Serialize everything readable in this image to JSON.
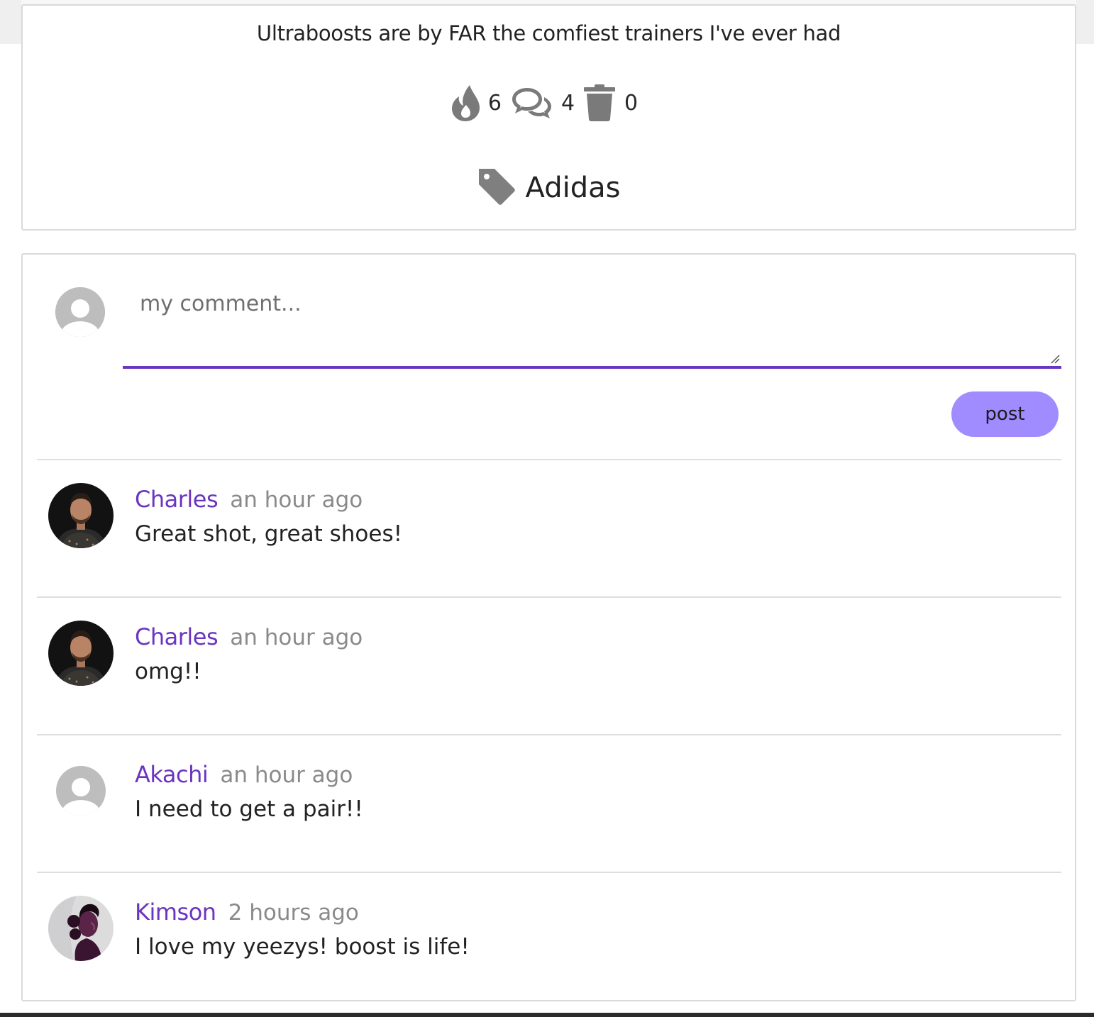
{
  "post": {
    "text": "Ultraboosts are by FAR the comfiest trainers I've ever had",
    "stats": {
      "fire_icon": "fire-icon",
      "fire_count": "6",
      "comments_icon": "comments-icon",
      "comments_count": "4",
      "trash_icon": "trash-icon",
      "trash_count": "0"
    },
    "tag": {
      "icon": "tag-icon",
      "label": "Adidas"
    }
  },
  "composer": {
    "placeholder": "my comment...",
    "value": "",
    "post_label": "post",
    "accent_color": "#6a35c0",
    "button_color": "#a08cff"
  },
  "comments": [
    {
      "author": "Charles",
      "time": "an hour ago",
      "text": "Great shot, great shoes!",
      "avatar": "photo"
    },
    {
      "author": "Charles",
      "time": "an hour ago",
      "text": "omg!!",
      "avatar": "photo"
    },
    {
      "author": "Akachi",
      "time": "an hour ago",
      "text": "I need to get a pair!!",
      "avatar": "default"
    },
    {
      "author": "Kimson",
      "time": "2 hours ago",
      "text": "I love my yeezys! boost is life!",
      "avatar": "photo"
    }
  ]
}
